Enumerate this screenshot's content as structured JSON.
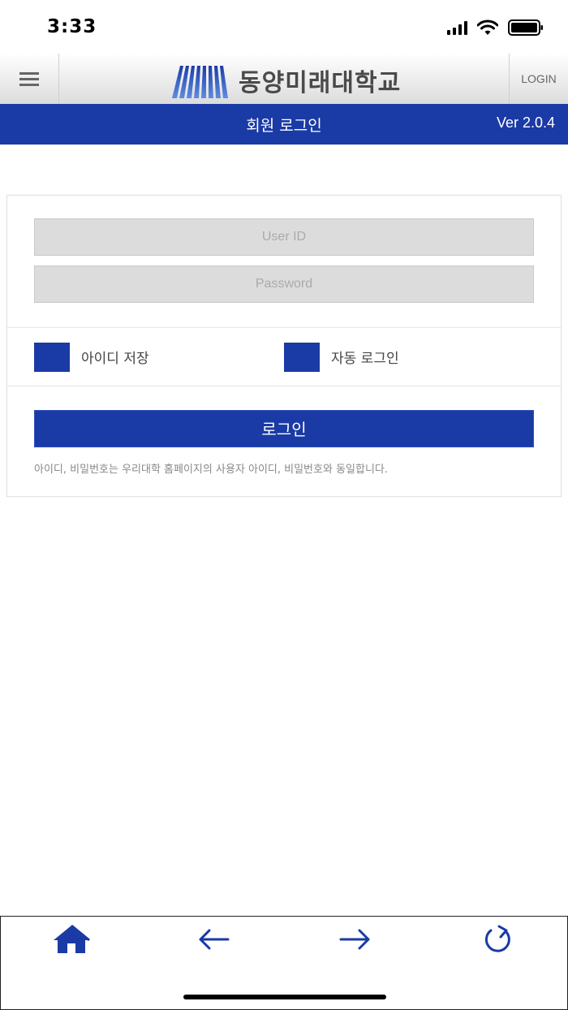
{
  "status_bar": {
    "time": "3:33"
  },
  "header": {
    "menu_icon": "hamburger-menu-icon",
    "logo_text": "동양미래대학교",
    "login_label": "LOGIN"
  },
  "title_bar": {
    "title": "회원 로그인",
    "version": "Ver 2.0.4"
  },
  "form": {
    "user_id_placeholder": "User ID",
    "password_placeholder": "Password",
    "save_id_label": "아이디 저장",
    "auto_login_label": "자동 로그인",
    "login_button": "로그인",
    "notice": "아이디, 비밀번호는 우리대학 홈페이지의 사용자 아이디, 비밀번호와 동일합니다."
  },
  "bottom_nav": [
    "home-icon",
    "back-arrow-icon",
    "forward-arrow-icon",
    "refresh-icon"
  ],
  "colors": {
    "primary": "#1a3aa5",
    "input_bg": "#dcdcdc"
  }
}
